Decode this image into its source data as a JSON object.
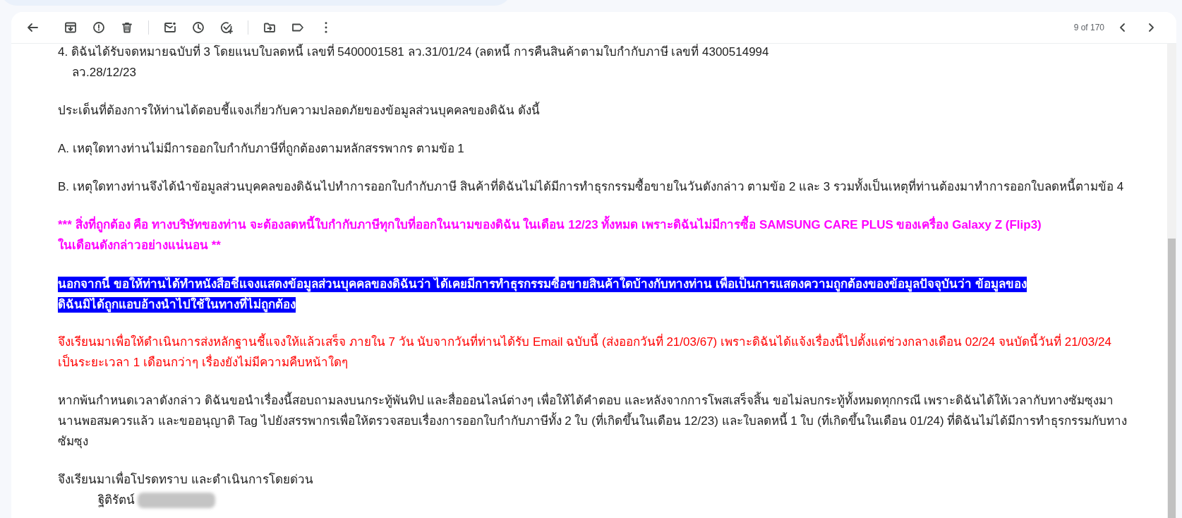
{
  "pager": {
    "text": "9 of 170"
  },
  "message": {
    "paragraphs": [
      {
        "kind": "plain",
        "lines": [
          "4. ดิฉันได้รับจดหมายฉบับที่ 3 โดยแนบใบลดหนี้ เลขที่ 5400001581 ลว.31/01/24 (ลดหนี้ การคืนสินค้าตามใบกำกับภาษี เลขที่  4300514994",
          "ลว.28/12/23"
        ],
        "indent_continuation": true
      },
      {
        "kind": "plain",
        "lines": [
          "ประเด็นที่ต้องการให้ท่านได้ตอบชี้แจงเกี่ยวกับความปลอดภัยของข้อมูลส่วนบุคคลของดิฉัน ดังนี้"
        ]
      },
      {
        "kind": "plain",
        "lines": [
          "A. เหตุใดทางท่านไม่มีการออกใบกำกับภาษีที่ถูกต้องตามหลักสรรพากร ตามข้อ 1"
        ]
      },
      {
        "kind": "plain",
        "lines": [
          "B. เหตุใดทางท่านจึงได้นำข้อมูลส่วนบุคคลของดิฉันไปทำการออกใบกำกับภาษี สินค้าที่ดิฉันไม่ได้มีการทำธุรกรรมซื้อขายในวันดังกล่าว ตามข้อ 2 และ 3 รวมทั้งเป็นเหตุที่ท่านต้องมาทำการออกใบลดหนี้ตามข้อ 4"
        ]
      },
      {
        "kind": "emphasis",
        "lines": [
          "*** สิ่งที่ถูกต้อง คือ ทางบริษัทของท่าน จะต้องลดหนี้ใบกำกับภาษีทุกใบที่ออกในนามของดิฉัน ในเดือน 12/23 ทั้งหมด เพราะดิฉันไม่มีการซื้อ SAMSUNG CARE PLUS ของเครื่อง Galaxy Z (Flip3)",
          "ในเดือนดังกล่าวอย่างแน่นอน **"
        ]
      },
      {
        "kind": "highlight",
        "lines": [
          "นอกจากนี้  ขอให้ท่านได้ทำหนังสือชี้แจงแสดงข้อมูลส่วนบุคคลของดิฉันว่า  ได้เคยมีการทำธุรกรรมซื้อขายสินค้าใดบ้างกับทางท่าน  เพื่อเป็นการแสดงความถูกต้องของข้อมูลปัจจุบันว่า ข้อมูลของ",
          "ดิฉันมิได้ถูกแอบอ้างนำไปใช้ในทางที่ไม่ถูกต้อง"
        ]
      },
      {
        "kind": "warning",
        "lines": [
          "จึงเรียนมาเพื่อให้ดำเนินการส่งหลักฐานชี้แจงให้แล้วเสร็จ ภายใน 7 วัน นับจากวันที่ท่านได้รับ Email ฉบับนี้ (ส่งออกวันที่ 21/03/67) เพราะดิฉันได้แจ้งเรื่องนี้ไปตั้งแต่ช่วงกลางเดือน 02/24  จนบัดนี้วันที่ 21/03/24",
          "เป็นระยะเวลา 1 เดือนกว่าๆ เรื่องยังไม่มีความคืบหน้าใดๆ"
        ]
      },
      {
        "kind": "plain",
        "lines": [
          "หากพ้นกำหนดเวลาดังกล่าว ดิฉันขอนำเรื่องนี้สอบถามลงบนกระทู้พันทิป และสื่อออนไลน์ต่างๆ เพื่อให้ได้คำตอบ  และหลังจากการโพสเสร็จสิ้น  ขอไม่ลบกระทู้ทั้งหมดทุกกรณี  เพราะดิฉันได้ให้เวลากับทางซัมซุงมา",
          "นานพอสมควรแล้ว และขออนุญาติ Tag ไปยังสรรพากรเพื่อให้ตรวจสอบเรื่องการออกใบกำกับภาษีทั้ง 2 ใบ (ที่เกิดขึ้นในเดือน 12/23) และใบลดหนี้ 1 ใบ (ที่เกิดขึ้นในเดือน 01/24) ที่ดิฉันไม่ได้มีการทำธุรกรรมกับทาง",
          "ซัมซุง"
        ]
      }
    ],
    "closing": "จึงเรียนมาเพื่อโปรดทราบ และดำเนินการโดยด่วน",
    "signature": {
      "name": "ฐิติรัตน์",
      "redacted": true
    }
  }
}
